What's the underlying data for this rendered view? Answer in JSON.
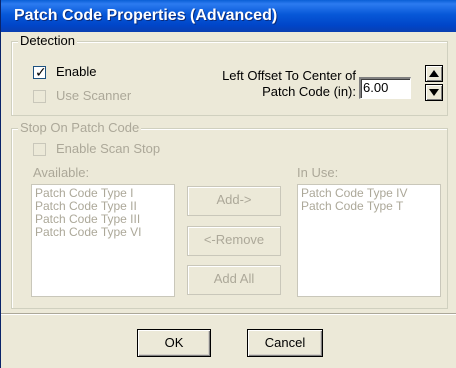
{
  "window": {
    "title": "Patch Code Properties (Advanced)"
  },
  "detection": {
    "legend": "Detection",
    "enable_label": "Enable",
    "enable_checked": true,
    "use_scanner_label": "Use Scanner",
    "use_scanner_checked": false,
    "offset_label_line1": "Left Offset To Center of",
    "offset_label_line2": "Patch Code (in):",
    "offset_value": "6.00"
  },
  "stop": {
    "legend": "Stop On Patch Code",
    "enable_scan_stop_label": "Enable Scan Stop",
    "available_label": "Available:",
    "available_items": [
      "Patch Code Type I",
      "Patch Code Type II",
      "Patch Code Type III",
      "Patch Code Type VI"
    ],
    "in_use_label": "In Use:",
    "in_use_items": [
      "Patch Code Type IV",
      "Patch Code Type T"
    ],
    "add_button": "Add->",
    "remove_button": "<-Remove",
    "add_all_button": "Add All"
  },
  "footer": {
    "ok_button": "OK",
    "cancel_button": "Cancel"
  },
  "colors": {
    "title_bar": "#0054e3",
    "disabled_text": "#aca899",
    "dialog_bg": "#ece9d8"
  },
  "icons": {
    "check": "checkmark-icon",
    "spin_up": "arrow-up-icon",
    "spin_down": "arrow-down-icon"
  }
}
